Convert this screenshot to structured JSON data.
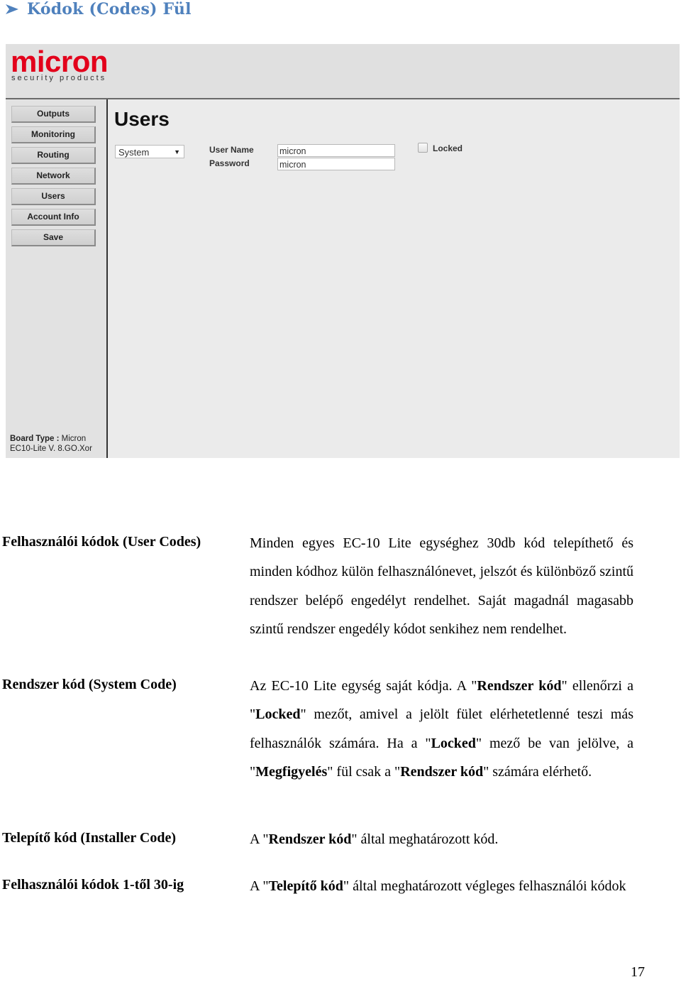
{
  "heading": {
    "icon": "arrow-bullet-icon",
    "title": "Kódok (Codes) Fül"
  },
  "ui_screenshot": {
    "logo": {
      "brand": "micron",
      "tagline": "security products",
      "brand_color": "#e3001b"
    },
    "sidebar": {
      "items": [
        {
          "label": "Outputs"
        },
        {
          "label": "Monitoring"
        },
        {
          "label": "Routing"
        },
        {
          "label": "Network"
        },
        {
          "label": "Users"
        },
        {
          "label": "Account Info"
        },
        {
          "label": "Save"
        }
      ],
      "board_type_label": "Board Type :",
      "board_type_value": "Micron",
      "firmware": "EC10-Lite V. 8.GO.Xor"
    },
    "main": {
      "title": "Users",
      "user_select": {
        "selected": "System"
      },
      "username_label": "User Name",
      "username_value": "micron",
      "password_label": "Password",
      "password_value": "micron",
      "locked_label": "Locked",
      "locked_checked": false
    }
  },
  "definitions": [
    {
      "term": "Felhasználói kódok (User Codes)",
      "description": "Minden egyes EC-10 Lite egységhez 30db kód telepíthető  és minden kódhoz külön felhasználónevet, jelszót és  különböző szintű rendszer belépő engedélyt rendelhet. Saját magadnál magasabb szintű rendszer engedély kódot senkihez nem rendelhet."
    },
    {
      "term": "Rendszer kód (System Code)",
      "parts": [
        {
          "text": "Az EC-10 Lite egység saját kódja. A \"",
          "bold": false
        },
        {
          "text": "Rendszer kód",
          "bold": true
        },
        {
          "text": "\" ellenőrzi a \"",
          "bold": false
        },
        {
          "text": "Locked",
          "bold": true
        },
        {
          "text": "\" mezőt, amivel a jelölt fület elérhetetlenné teszi más felhasználók számára. Ha a \"",
          "bold": false
        },
        {
          "text": "Locked",
          "bold": true
        },
        {
          "text": "\" mező be van jelölve, a \"",
          "bold": false
        },
        {
          "text": "Megfigyelés",
          "bold": true
        },
        {
          "text": "\"  fül csak a \"",
          "bold": false
        },
        {
          "text": "Rendszer kód",
          "bold": true
        },
        {
          "text": "\" számára elérhető.",
          "bold": false
        }
      ]
    },
    {
      "term": "Telepítő kód (Installer Code)",
      "parts": [
        {
          "text": "A \"",
          "bold": false
        },
        {
          "text": "Rendszer kód",
          "bold": true
        },
        {
          "text": "\" által meghatározott kód.",
          "bold": false
        }
      ]
    },
    {
      "term": "Felhasználói kódok 1-től 30-ig",
      "parts": [
        {
          "text": "A \"",
          "bold": false
        },
        {
          "text": "Telepítő kód",
          "bold": true
        },
        {
          "text": "\" által meghatározott végleges felhasználói kódok",
          "bold": false
        }
      ]
    }
  ],
  "page_number": "17"
}
